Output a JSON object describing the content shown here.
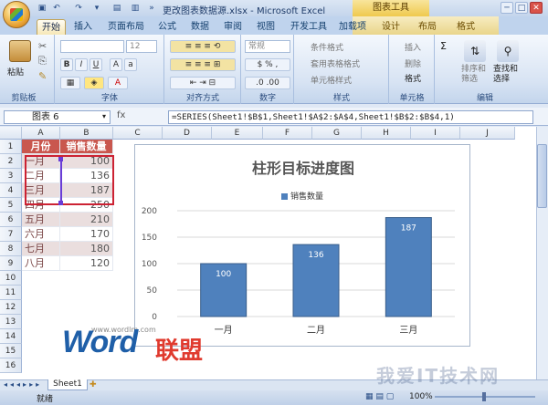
{
  "window": {
    "title": "更改图表数据源.xlsx - Microsoft Excel",
    "context_title": "图表工具",
    "min": "─",
    "max": "□",
    "close": "✕"
  },
  "tabs": [
    "开始",
    "插入",
    "页面布局",
    "公式",
    "数据",
    "审阅",
    "视图",
    "开发工具",
    "加载项",
    "设计",
    "布局",
    "格式"
  ],
  "ribbon": {
    "clipboard": {
      "label": "剪贴板",
      "paste": "粘贴"
    },
    "font": {
      "label": "字体",
      "size": "12"
    },
    "align": {
      "label": "对齐方式"
    },
    "number": {
      "label": "数字",
      "format": "常规"
    },
    "styles": {
      "label": "样式",
      "cond": "条件格式",
      "table": "套用表格格式",
      "cell": "单元格样式"
    },
    "cells": {
      "label": "单元格",
      "insert": "插入",
      "delete": "删除",
      "format": "格式"
    },
    "editing": {
      "label": "编辑",
      "sort": "排序和\n筛选",
      "find": "查找和\n选择"
    }
  },
  "formula_bar": {
    "name_box": "图表 6",
    "fx": "fx",
    "formula": "=SERIES(Sheet1!$B$1,Sheet1!$A$2:$A$4,Sheet1!$B$2:$B$4,1)"
  },
  "columns": [
    "A",
    "B",
    "C",
    "D",
    "E",
    "F",
    "G",
    "H",
    "I",
    "J"
  ],
  "rows": [
    "1",
    "2",
    "3",
    "4",
    "5",
    "6",
    "7",
    "8",
    "9",
    "10",
    "11",
    "12",
    "13",
    "14",
    "15",
    "16"
  ],
  "table": {
    "headers": [
      "月份",
      "销售数量"
    ],
    "rows": [
      [
        "一月",
        "100"
      ],
      [
        "二月",
        "136"
      ],
      [
        "三月",
        "187"
      ],
      [
        "四月",
        "250"
      ],
      [
        "五月",
        "210"
      ],
      [
        "六月",
        "170"
      ],
      [
        "七月",
        "180"
      ],
      [
        "八月",
        "120"
      ]
    ]
  },
  "chart_data": {
    "type": "bar",
    "title": "柱形目标进度图",
    "categories": [
      "一月",
      "二月",
      "三月"
    ],
    "series": [
      {
        "name": "销售数量",
        "values": [
          100,
          136,
          187
        ]
      }
    ],
    "ylim": [
      0,
      200
    ],
    "yticks": [
      0,
      50,
      100,
      150,
      200
    ],
    "grid": true,
    "legend": "top"
  },
  "sheets": {
    "tab": "Sheet1"
  },
  "status": {
    "ready": "就绪",
    "zoom": "100%"
  },
  "logo": {
    "word": "Word",
    "cn": "联盟",
    "url": "www.wordlm.com",
    "watermark": "我爱IT技术网"
  },
  "colors": {
    "accent": "#4f81bd",
    "header": "#c9574e",
    "selection": "#cc2233"
  }
}
